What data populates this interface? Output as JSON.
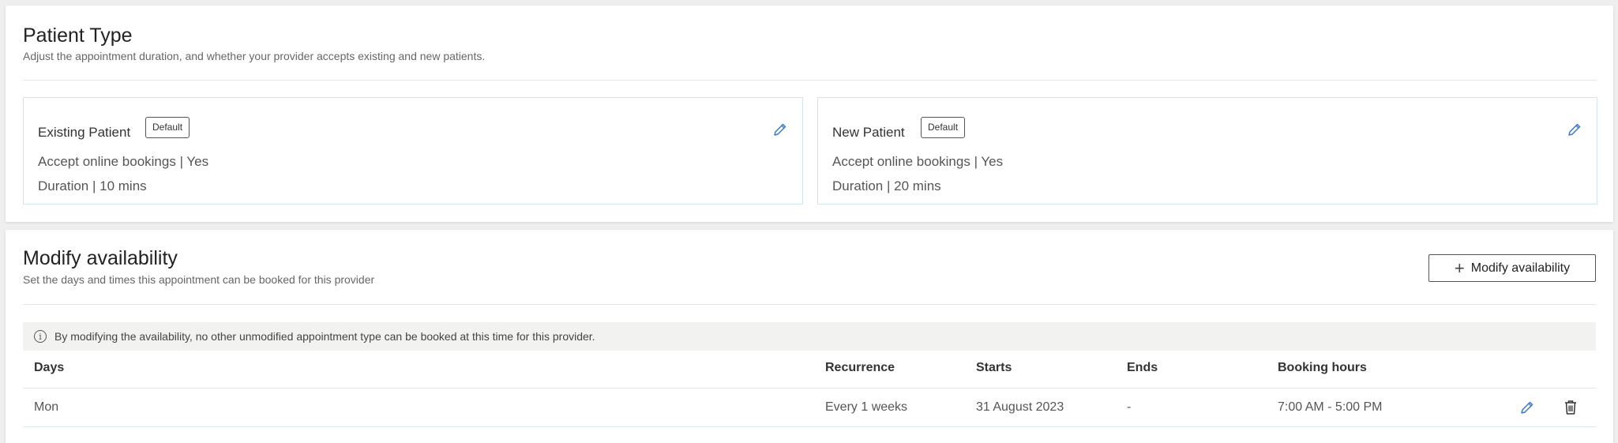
{
  "patient_type": {
    "title": "Patient Type",
    "subtitle": "Adjust the appointment duration, and whether your provider accepts existing and new patients.",
    "cards": [
      {
        "name": "Existing Patient",
        "badge": "Default",
        "bookings": "Accept online bookings | Yes",
        "duration": "Duration | 10 mins"
      },
      {
        "name": "New Patient",
        "badge": "Default",
        "bookings": "Accept online bookings | Yes",
        "duration": "Duration | 20 mins"
      }
    ]
  },
  "availability": {
    "title": "Modify availability",
    "subtitle": "Set the days and times this appointment can be booked for this provider",
    "button_label": "Modify availability",
    "info": "By modifying the availability, no other unmodified appointment type can be booked at this time for this provider.",
    "columns": [
      "Days",
      "Recurrence",
      "Starts",
      "Ends",
      "Booking hours"
    ],
    "rows": [
      {
        "days": "Mon",
        "recurrence": "Every 1 weeks",
        "starts": "31 August 2023",
        "ends": "-",
        "hours": "7:00 AM - 5:00 PM"
      }
    ]
  },
  "colors": {
    "accent": "#3a78c9",
    "divider": "#d8ecec"
  }
}
